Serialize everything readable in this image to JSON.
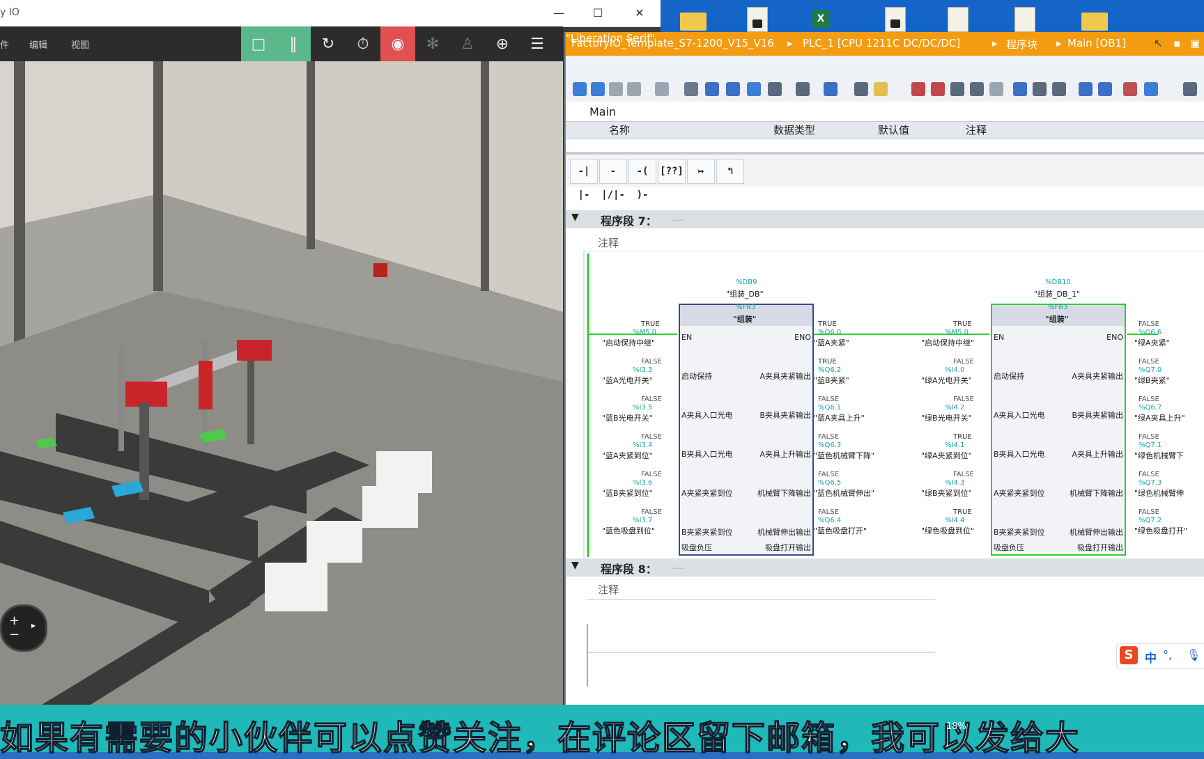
{
  "factoryio": {
    "title": "y IO",
    "menus": [
      "件",
      "编辑",
      "视图"
    ]
  },
  "tia": {
    "breadcrumb": [
      "FactoryIO_Template_S7-1200_V15_V16",
      "PLC_1 [CPU 1211C DC/DC/DC]",
      "程序块",
      "Main [OB1]"
    ],
    "block_name": "Main",
    "interface_headers": [
      "名称",
      "数据类型",
      "默认值",
      "注释"
    ],
    "network7": {
      "title": "程序段 7：",
      "dots": ".....",
      "comment": "注释"
    },
    "network8": {
      "title": "程序段 8：",
      "dots": ".....",
      "comment": "注释"
    },
    "block1": {
      "db": "%DB9",
      "db_name": "\"组装_DB\"",
      "fb": "%FB3",
      "name": "\"组装\"",
      "en": "EN",
      "eno": "ENO",
      "in_pins": [
        "启动保持",
        "A夹具入口光电",
        "B夹具入口光电",
        "A夹紧夹紧到位",
        "B夹紧夹紧到位",
        "吸盘负压"
      ],
      "out_pins": [
        "A夹具夹紧输出",
        "B夹具夹紧输出",
        "A夹具上升输出",
        "机械臂下降输出",
        "机械臂伸出输出",
        "吸盘打开输出"
      ],
      "in_vals": [
        "TRUE",
        "FALSE",
        "FALSE",
        "FALSE",
        "FALSE",
        "FALSE"
      ],
      "in_addrs": [
        "%M5.0",
        "%I3.3",
        "%I3.5",
        "%I3.4",
        "%I3.6",
        "%I3.7"
      ],
      "in_tags": [
        "\"启动保持中继\"",
        "\"蓝A光电开关\"",
        "\"蓝B光电开关\"",
        "\"蓝A夹紧到位\"",
        "\"蓝B夹紧到位\"",
        "\"蓝色吸盘到位\""
      ],
      "out_vals": [
        "TRUE",
        "TRUE",
        "FALSE",
        "FALSE",
        "FALSE",
        "FALSE"
      ],
      "out_addrs": [
        "%Q6.0",
        "%Q6.2",
        "%Q6.1",
        "%Q6.3",
        "%Q6.5",
        "%Q6.4"
      ],
      "out_tags": [
        "\"蓝A夹紧\"",
        "\"蓝B夹紧\"",
        "\"蓝A夹具上升\"",
        "\"蓝色机械臂下降\"",
        "\"蓝色机械臂伸出\"",
        "\"蓝色吸盘打开\""
      ]
    },
    "block2": {
      "db": "%DB10",
      "db_name": "\"组装_DB_1\"",
      "fb": "%FB3",
      "name": "\"组装\"",
      "en": "EN",
      "eno": "ENO",
      "in_pins": [
        "启动保持",
        "A夹具入口光电",
        "B夹具入口光电",
        "A夹紧夹紧到位",
        "B夹紧夹紧到位",
        "吸盘负压"
      ],
      "out_pins": [
        "A夹具夹紧输出",
        "B夹具夹紧输出",
        "A夹具上升输出",
        "机械臂下降输出",
        "机械臂伸出输出",
        "吸盘打开输出"
      ],
      "in_vals": [
        "TRUE",
        "FALSE",
        "FALSE",
        "TRUE",
        "FALSE",
        "TRUE"
      ],
      "in_addrs": [
        "%M5.0",
        "%I4.0",
        "%I4.2",
        "%I4.1",
        "%I4.3",
        "%I4.4"
      ],
      "in_tags": [
        "\"启动保持中继\"",
        "\"绿A光电开关\"",
        "\"绿B光电开关\"",
        "\"绿A夹紧到位\"",
        "\"绿B夹紧到位\"",
        "\"绿色吸盘到位\""
      ],
      "out_vals": [
        "FALSE",
        "FALSE",
        "FALSE",
        "FALSE",
        "FALSE",
        "FALSE"
      ],
      "out_addrs": [
        "%Q6.6",
        "%Q7.0",
        "%Q6.7",
        "%Q7.1",
        "%Q7.3",
        "%Q7.2"
      ],
      "out_tags": [
        "\"绿A夹紧\"",
        "\"绿B夹紧\"",
        "\"绿A夹具上升\"",
        "\"绿色机械臂下",
        "\"绿色机械臂伸",
        "\"绿色吸盘打开\""
      ]
    },
    "ime": "中",
    "ime_punct": "°,"
  },
  "subtitle": "如果有需要的小伙伴可以点赞关注，在评论区留下邮箱，我可以发给大",
  "taskbar_percent": "18%"
}
